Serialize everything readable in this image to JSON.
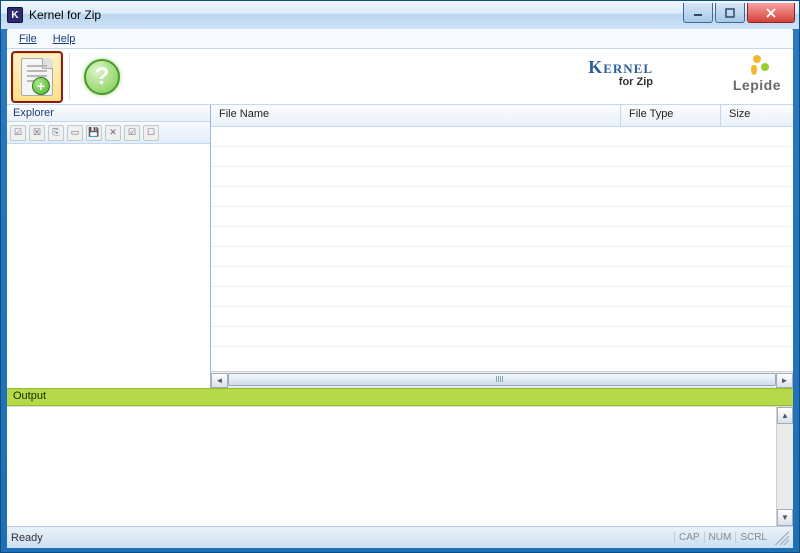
{
  "window": {
    "title": "Kernel for Zip"
  },
  "menu": {
    "file": "File",
    "help": "Help"
  },
  "brand": {
    "name": "Kernel",
    "sub": "for Zip",
    "company": "Lepide"
  },
  "panes": {
    "explorer_title": "Explorer",
    "output_title": "Output"
  },
  "columns": {
    "file_name": "File Name",
    "file_type": "File Type",
    "size": "Size"
  },
  "status": {
    "ready": "Ready",
    "cap": "CAP",
    "num": "NUM",
    "scrl": "SCRL"
  }
}
